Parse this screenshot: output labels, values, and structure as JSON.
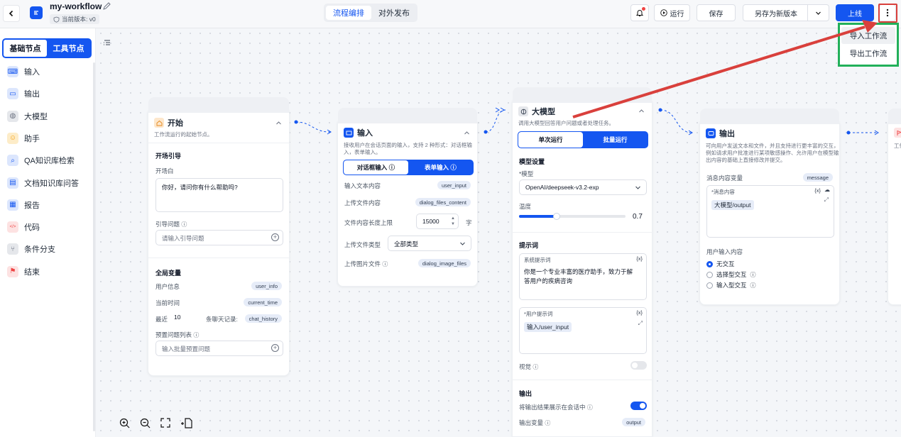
{
  "header": {
    "workflow_name": "my-workflow",
    "version_label": "当前版本: v0",
    "tabs": [
      "流程编排",
      "对外发布"
    ],
    "run_label": "运行",
    "save_label": "保存",
    "save_as_label": "另存为新版本",
    "publish_label": "上线"
  },
  "more_menu": {
    "items": [
      "导入工作流",
      "导出工作流"
    ],
    "highlight_color": "#22b05a",
    "arrow_color": "#d9403c"
  },
  "sidebar": {
    "tabs": [
      "基础节点",
      "工具节点"
    ],
    "items": [
      {
        "label": "输入",
        "icon": "input-icon",
        "color": "#1456f0"
      },
      {
        "label": "输出",
        "icon": "output-icon",
        "color": "#1456f0"
      },
      {
        "label": "大模型",
        "icon": "brain-icon",
        "color": "#6b7280"
      },
      {
        "label": "助手",
        "icon": "assistant-icon",
        "color": "#f59e0b"
      },
      {
        "label": "QA知识库检索",
        "icon": "qa-search-icon",
        "color": "#1456f0"
      },
      {
        "label": "文档知识库问答",
        "icon": "book-icon",
        "color": "#1456f0"
      },
      {
        "label": "报告",
        "icon": "report-icon",
        "color": "#1456f0"
      },
      {
        "label": "代码",
        "icon": "code-icon",
        "color": "#ef4444"
      },
      {
        "label": "条件分支",
        "icon": "branch-icon",
        "color": "#6b7280"
      },
      {
        "label": "结束",
        "icon": "flag-icon",
        "color": "#ef4444"
      }
    ]
  },
  "start_node": {
    "title": "开始",
    "desc": "工作流运行的起始节点。",
    "opening_section": "开场引导",
    "opening_label": "开场白",
    "opening_value": "你好，请问你有什么帮助吗?",
    "guide_label": "引导问题",
    "guide_placeholder": "请输入引导问题",
    "global_section": "全局变量",
    "vars": [
      {
        "label": "用户信息",
        "tag": "user_info"
      },
      {
        "label": "当前时间",
        "tag": "current_time"
      }
    ],
    "history_prefix": "最近",
    "history_count": "10",
    "history_suffix": "条聊天记录:",
    "history_tag": "chat_history",
    "preset_label": "预置问题列表",
    "preset_placeholder": "输入批量预置问题"
  },
  "input_node": {
    "title": "输入",
    "desc1": "接收用户在会话页面的输入，支持 2 种形式：对话框输",
    "desc2": "入，表单输入。",
    "seg": [
      "对话框输入",
      "表单输入"
    ],
    "rows": [
      {
        "label": "输入文本内容",
        "tag": "user_input"
      },
      {
        "label": "上传文件内容",
        "tag": "dialog_files_content"
      }
    ],
    "limit_label": "文件内容长度上限",
    "limit_value": "15000",
    "limit_unit": "字",
    "filetype_label": "上传文件类型",
    "filetype_value": "全部类型",
    "image_label": "上传图片文件",
    "image_tag": "dialog_image_files"
  },
  "llm_node": {
    "title": "大模型",
    "desc": "调用大模型回答用户问题或者处理任务。",
    "seg": [
      "单次运行",
      "批量运行"
    ],
    "model_section": "模型设置",
    "model_label": "*模型",
    "model_value": "OpenAI/deepseek-v3.2-exp",
    "temp_label": "温度",
    "temp_value": "0.7",
    "temp_fraction": 0.7,
    "prompt_section": "提示词",
    "system_label": "系统提示词",
    "system_value": "你是一个专业丰富的医疗助手，致力于解答用户的疾病咨询",
    "user_label": "*用户提示词",
    "user_value": "输入/user_input",
    "vision_label": "视觉",
    "output_section": "输出",
    "show_output_label": "将输出结果展示在会话中",
    "output_var_label": "输出变量",
    "output_var_tag": "output"
  },
  "output_node": {
    "title": "输出",
    "desc1": "可向用户发送文本和文件，并且支持进行更丰富的交互，",
    "desc2": "例如请求用户批准进行某项敏感操作、允许用户在模型输",
    "desc3": "出内容的基础上直接修改并提交。",
    "msg_var_label": "消息内容变量",
    "msg_var_tag": "message",
    "msg_content_label": "*消息内容",
    "msg_content_value": "大模型/output",
    "interaction_label": "用户输入内容",
    "options": [
      "无交互",
      "选择型交互",
      "输入型交互"
    ],
    "selected": 0
  },
  "next_node": {
    "desc": "工作"
  },
  "colors": {
    "primary": "#1456f0",
    "sidebar_active_bg": "#1456f0"
  }
}
